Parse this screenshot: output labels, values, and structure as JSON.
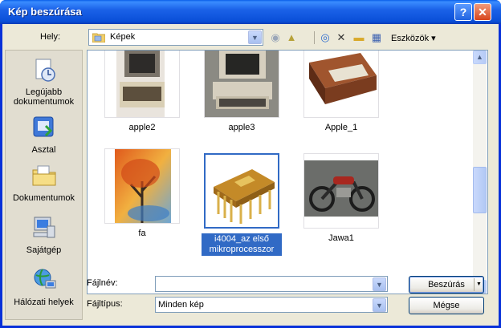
{
  "window": {
    "title": "Kép beszúrása",
    "help_label": "?",
    "close_label": "✕"
  },
  "toolbar": {
    "lookin_label": "Hely:",
    "lookin_value": "Képek",
    "tools_label": "Eszközök",
    "icons": [
      "back-icon",
      "up-folder-icon",
      "search-web-icon",
      "delete-icon",
      "new-folder-icon",
      "views-icon"
    ]
  },
  "places": [
    {
      "label": "Legújabb dokumentumok",
      "icon": "recent-documents-icon"
    },
    {
      "label": "Asztal",
      "icon": "desktop-icon"
    },
    {
      "label": "Dokumentumok",
      "icon": "documents-icon"
    },
    {
      "label": "Sajátgép",
      "icon": "my-computer-icon"
    },
    {
      "label": "Hálózati helyek",
      "icon": "network-places-icon"
    }
  ],
  "files": [
    {
      "name": "apple2",
      "selected": false
    },
    {
      "name": "apple3",
      "selected": false
    },
    {
      "name": "Apple_1",
      "selected": false
    },
    {
      "name": "fa",
      "selected": false
    },
    {
      "name": "i4004_az első mikroprocesszor",
      "selected": true
    },
    {
      "name": "Jawa1",
      "selected": false
    }
  ],
  "bottom": {
    "filename_label": "Fájlnév:",
    "filename_value": "",
    "filetype_label": "Fájltípus:",
    "filetype_value": "Minden kép",
    "insert_label": "Beszúrás",
    "cancel_label": "Mégse"
  }
}
